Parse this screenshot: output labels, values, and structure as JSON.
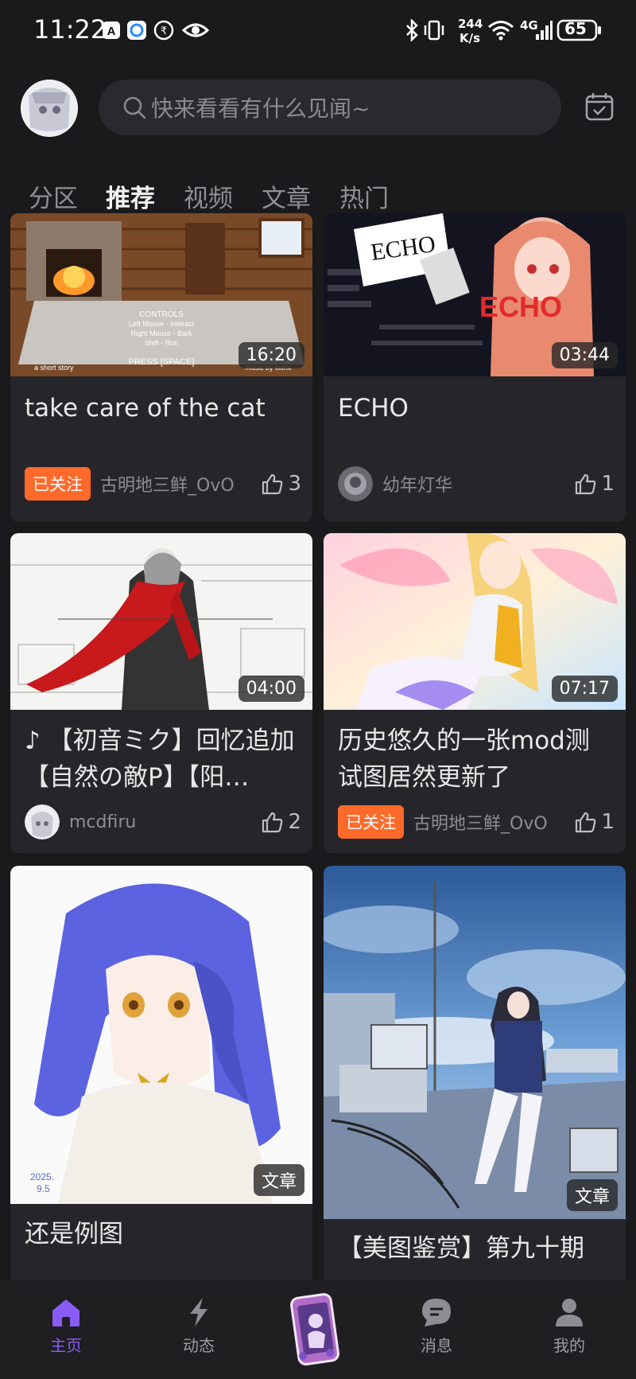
{
  "status_bar": {
    "time": "11:22",
    "net_speed_value": "244",
    "net_speed_unit": "K/s",
    "network": "4G",
    "battery": "65",
    "icons": [
      "a-icon",
      "browser-icon",
      "rupee-icon",
      "eye-icon",
      "bluetooth-icon",
      "vibrate-icon",
      "wifi-icon",
      "signal-icon",
      "battery-icon"
    ]
  },
  "header": {
    "search_placeholder": "快来看看有什么见闻~"
  },
  "tabs": [
    {
      "label": "分区"
    },
    {
      "label": "推荐"
    },
    {
      "label": "视频"
    },
    {
      "label": "文章"
    },
    {
      "label": "热门"
    }
  ],
  "active_tab": "推荐",
  "cards": [
    {
      "title": "take care of the cat",
      "duration": "16:20",
      "follow": "已关注",
      "author": "古明地三鲜_OvO",
      "likes": "3"
    },
    {
      "title": "ECHO",
      "duration": "03:44",
      "author": "幼年灯华",
      "likes": "1"
    },
    {
      "title": "♪ 【初音ミク】回忆追加【自然の敵P】【阳…",
      "duration": "04:00",
      "author": "mcdfiru",
      "likes": "2"
    },
    {
      "title": "历史悠久的一张mod测试图居然更新了",
      "duration": "07:17",
      "follow": "已关注",
      "author": "古明地三鲜_OvO",
      "likes": "1"
    },
    {
      "title": "还是例图",
      "tag": "文章"
    },
    {
      "title": "【美图鉴赏】第九十期",
      "tag": "文章"
    }
  ],
  "bottom_nav": [
    {
      "label": "主页"
    },
    {
      "label": "动态"
    },
    {
      "label": "消息"
    },
    {
      "label": "我的"
    }
  ],
  "colors": {
    "accent": "#8a5cf6",
    "follow": "#ff6a2b",
    "background": "#1a1a1c",
    "card": "#26262a"
  }
}
